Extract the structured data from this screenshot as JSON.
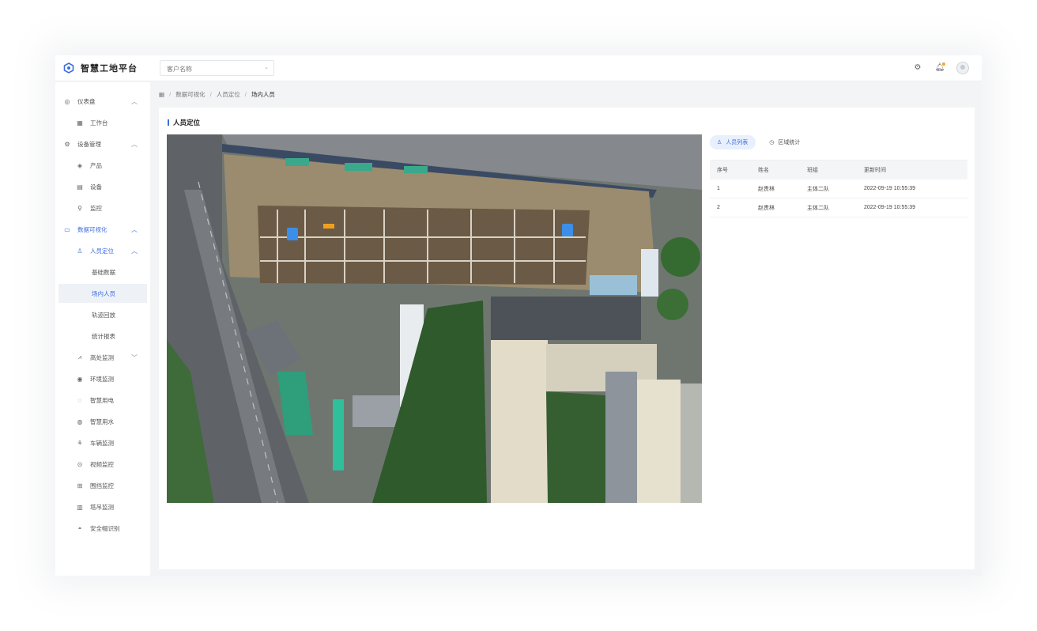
{
  "app": {
    "title": "智慧工地平台"
  },
  "header": {
    "project_select": {
      "value": "客户名称"
    },
    "icons": [
      "settings-icon",
      "bell-icon",
      "avatar"
    ]
  },
  "sidebar": {
    "items": [
      {
        "label": "仪表盘",
        "icon": "dashboard-icon",
        "arrow": "︿"
      },
      {
        "label": "工作台",
        "icon": "grid-icon"
      },
      {
        "label": "设备管理",
        "icon": "gear-icon",
        "arrow": "︿"
      },
      {
        "label": "产品",
        "icon": "cube-icon"
      },
      {
        "label": "设备",
        "icon": "device-icon"
      },
      {
        "label": "监控",
        "icon": "pin-icon"
      },
      {
        "label": "数据可视化",
        "icon": "monitor-icon",
        "arrow": "︿"
      },
      {
        "label": "人员定位",
        "icon": "person-pin-icon",
        "arrow": "︿"
      },
      {
        "label": "基础数据",
        "icon": ""
      },
      {
        "label": "场内人员",
        "icon": ""
      },
      {
        "label": "轨迹回放",
        "icon": ""
      },
      {
        "label": "统计报表",
        "icon": ""
      },
      {
        "label": "高处监测",
        "icon": "chart-icon",
        "arrow": "﹀"
      },
      {
        "label": "环境监测",
        "icon": "leaf-icon"
      },
      {
        "label": "智慧用电",
        "icon": "bolt-icon"
      },
      {
        "label": "智慧用水",
        "icon": "drop-icon"
      },
      {
        "label": "车辆监测",
        "icon": "car-icon"
      },
      {
        "label": "视频监控",
        "icon": "camera-icon"
      },
      {
        "label": "围挡监控",
        "icon": "fence-icon"
      },
      {
        "label": "塔吊监测",
        "icon": "crane-icon"
      },
      {
        "label": "安全帽识别",
        "icon": "helmet-icon"
      }
    ]
  },
  "breadcrumb": [
    "数据可视化",
    "人员定位",
    "场内人员"
  ],
  "panel": {
    "title": "人员定位"
  },
  "tabs": [
    {
      "label": "人员列表",
      "icon": "people-icon",
      "active": true
    },
    {
      "label": "区域统计",
      "icon": "clock-icon",
      "active": false
    }
  ],
  "table": {
    "columns": [
      "序号",
      "姓名",
      "班组",
      "更新时间"
    ],
    "rows": [
      [
        "1",
        "赵贵林",
        "主体二队",
        "2022-09-19 10:55:39"
      ],
      [
        "2",
        "赵贵林",
        "主体二队",
        "2022-09-19 10:55:39"
      ]
    ]
  },
  "colors": {
    "accent": "#3c6ee0",
    "badge": "#f5a623",
    "page_bg": "#f3f4f6"
  }
}
